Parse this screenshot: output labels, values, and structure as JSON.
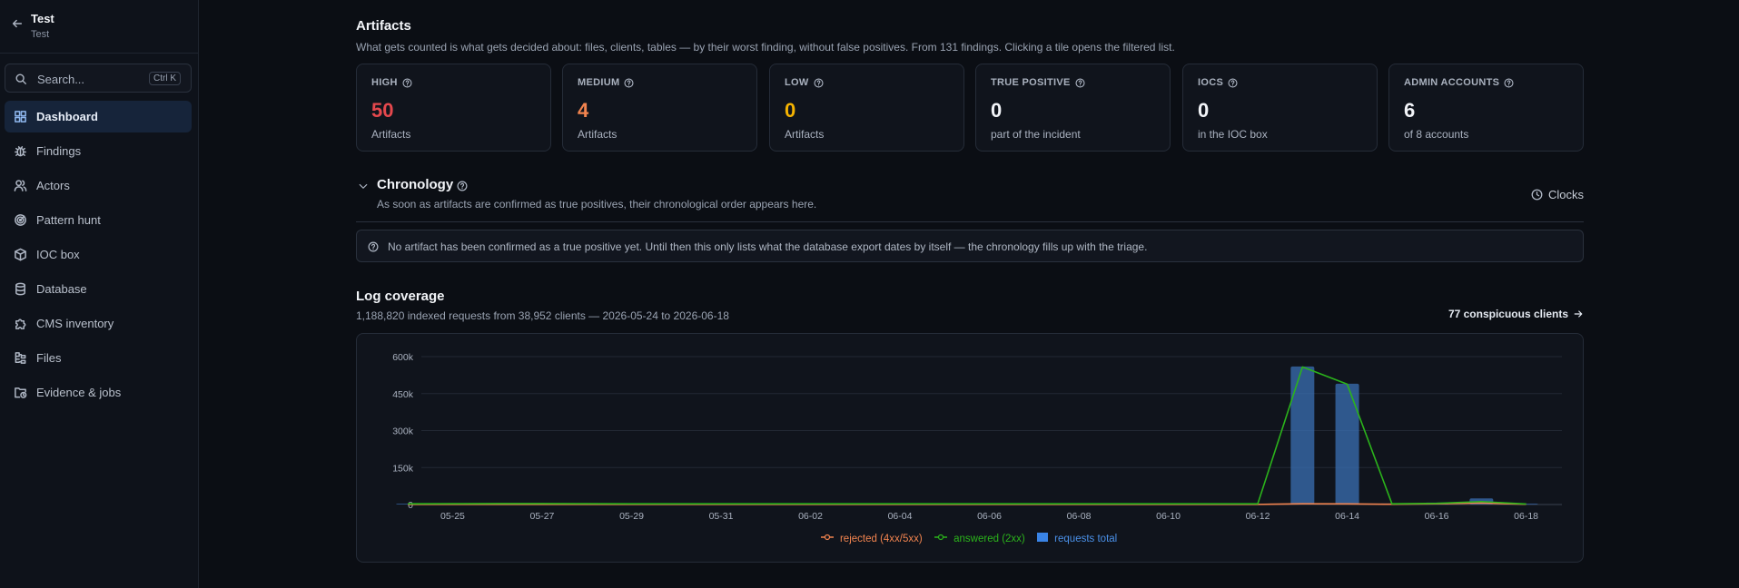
{
  "workspace": {
    "name": "Test",
    "subtitle": "Test"
  },
  "search": {
    "placeholder": "Search...",
    "shortcut": "Ctrl K"
  },
  "sidebar": {
    "items": [
      {
        "label": "Dashboard",
        "icon": "dashboard-icon",
        "active": true
      },
      {
        "label": "Findings",
        "icon": "bug-icon",
        "active": false
      },
      {
        "label": "Actors",
        "icon": "users-icon",
        "active": false
      },
      {
        "label": "Pattern hunt",
        "icon": "radar-icon",
        "active": false
      },
      {
        "label": "IOC box",
        "icon": "box-icon",
        "active": false
      },
      {
        "label": "Database",
        "icon": "database-icon",
        "active": false
      },
      {
        "label": "CMS inventory",
        "icon": "puzzle-icon",
        "active": false
      },
      {
        "label": "Files",
        "icon": "files-icon",
        "active": false
      },
      {
        "label": "Evidence & jobs",
        "icon": "folder-clock-icon",
        "active": false
      }
    ]
  },
  "artifacts": {
    "title": "Artifacts",
    "description": "What gets counted is what gets decided about: files, clients, tables — by their worst finding, without false positives. From 131 findings. Clicking a tile opens the filtered list.",
    "tiles": [
      {
        "label": "HIGH",
        "value": "50",
        "sub": "Artifacts",
        "color": "#e5484d"
      },
      {
        "label": "MEDIUM",
        "value": "4",
        "sub": "Artifacts",
        "color": "#f2844f"
      },
      {
        "label": "LOW",
        "value": "0",
        "sub": "Artifacts",
        "color": "#f5b301"
      },
      {
        "label": "TRUE POSITIVE",
        "value": "0",
        "sub": "part of the incident",
        "color": "#f2f4f8"
      },
      {
        "label": "IOCS",
        "value": "0",
        "sub": "in the IOC box",
        "color": "#f2f4f8"
      },
      {
        "label": "ADMIN ACCOUNTS",
        "value": "6",
        "sub": "of 8 accounts",
        "color": "#f2f4f8"
      }
    ]
  },
  "chronology": {
    "title": "Chronology",
    "description": "As soon as artifacts are confirmed as true positives, their chronological order appears here.",
    "clocks_label": "Clocks",
    "notice": "No artifact has been confirmed as a true positive yet. Until then this only lists what the database export dates by itself — the chronology fills up with the triage."
  },
  "log_coverage": {
    "title": "Log coverage",
    "summary": "1,188,820 indexed requests from 38,952 clients — 2026-05-24 to 2026-06-18",
    "link_label": "77 conspicuous clients"
  },
  "chart_data": {
    "type": "bar",
    "x": [
      "05-24",
      "05-25",
      "05-26",
      "05-27",
      "05-28",
      "05-29",
      "05-30",
      "05-31",
      "06-01",
      "06-02",
      "06-03",
      "06-04",
      "06-05",
      "06-06",
      "06-07",
      "06-08",
      "06-09",
      "06-10",
      "06-11",
      "06-12",
      "06-13",
      "06-14",
      "06-15",
      "06-16",
      "06-17",
      "06-18"
    ],
    "x_tick_labels": [
      "05-25",
      "05-27",
      "05-29",
      "05-31",
      "06-02",
      "06-04",
      "06-06",
      "06-08",
      "06-10",
      "06-12",
      "06-14",
      "06-16",
      "06-18"
    ],
    "y_tick_labels": [
      "0",
      "150k",
      "300k",
      "450k",
      "600k"
    ],
    "ylim": [
      0,
      600000
    ],
    "series": [
      {
        "name": "rejected (4xx/5xx)",
        "type": "line",
        "color": "#f2844f",
        "values": [
          500,
          500,
          500,
          500,
          500,
          500,
          500,
          500,
          500,
          500,
          500,
          500,
          500,
          500,
          500,
          500,
          500,
          500,
          500,
          500,
          3000,
          2500,
          1000,
          3000,
          6000,
          1000
        ]
      },
      {
        "name": "answered (2xx)",
        "type": "line",
        "color": "#2bb31b",
        "values": [
          3000,
          3500,
          4000,
          4000,
          3500,
          3000,
          3000,
          3000,
          3000,
          3000,
          3000,
          3000,
          3000,
          3000,
          3000,
          3000,
          3000,
          3000,
          3000,
          3000,
          558000,
          488000,
          3000,
          5000,
          12000,
          2000
        ]
      },
      {
        "name": "requests total",
        "type": "bar",
        "color": "#3a84e6",
        "values": [
          3000,
          3500,
          4000,
          4000,
          3500,
          3000,
          3000,
          3000,
          3000,
          3000,
          3000,
          3000,
          3000,
          3000,
          3000,
          3000,
          3000,
          3000,
          3000,
          3000,
          560000,
          490000,
          4000,
          8000,
          25000,
          3000
        ]
      }
    ],
    "grid": true,
    "legend": "bottom-center"
  }
}
